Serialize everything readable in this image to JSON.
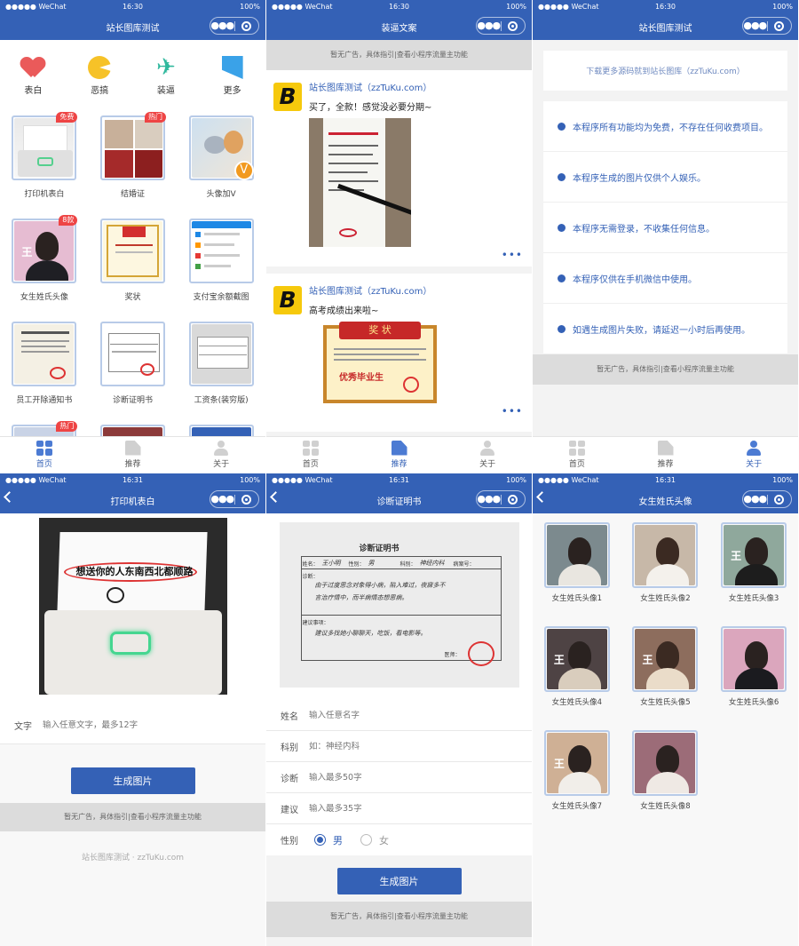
{
  "status": {
    "carrier": "●●●●● WeChat",
    "battery": "100%",
    "times": [
      "16:30",
      "16:30",
      "16:30",
      "16:31",
      "16:31",
      "16:31"
    ]
  },
  "titles": [
    "站长图库测试",
    "装逼文案",
    "站长图库测试",
    "打印机表白",
    "诊断证明书",
    "女生姓氏头像"
  ],
  "colors": {
    "primary": "#3461b6",
    "badge": "#ee4444"
  },
  "ad_text": "暂无广告，具体指引|查看小程序流量主功能",
  "tabbar": [
    {
      "label": "首页",
      "icon": "home-icon"
    },
    {
      "label": "推荐",
      "icon": "recommend-icon"
    },
    {
      "label": "关于",
      "icon": "about-icon"
    }
  ],
  "home": {
    "categories": [
      {
        "label": "表白",
        "icon": "heart-icon"
      },
      {
        "label": "恶搞",
        "icon": "smile-icon"
      },
      {
        "label": "装逼",
        "icon": "plane-icon"
      },
      {
        "label": "更多",
        "icon": "bookmark-icon"
      }
    ],
    "tiles": [
      {
        "label": "打印机表白",
        "badge": "免费"
      },
      {
        "label": "结婚证",
        "badge": "热门"
      },
      {
        "label": "头像加V",
        "badge": ""
      },
      {
        "label": "女生姓氏头像",
        "badge": "8款"
      },
      {
        "label": "奖状",
        "badge": ""
      },
      {
        "label": "支付宝余额截图",
        "badge": ""
      },
      {
        "label": "员工开除通知书",
        "badge": ""
      },
      {
        "label": "诊断证明书",
        "badge": ""
      },
      {
        "label": "工资条(装穷版)",
        "badge": ""
      }
    ],
    "partial_badge": "热门",
    "vbadge": "V"
  },
  "feed": {
    "posts": [
      {
        "name": "站长图库测试（zzTuKu.com）",
        "text": "买了，全款！感觉没必要分期~"
      },
      {
        "name": "站长图库测试（zzTuKu.com）",
        "text": "高考成绩出来啦~"
      }
    ],
    "logo": "B",
    "certificate": {
      "title": "奖 状",
      "banner": "优秀毕业生"
    }
  },
  "about": {
    "download_text": "下载更多源码就到站长图库（zzTuKu.com）",
    "notes": [
      "本程序所有功能均为免费，不存在任何收费项目。",
      "本程序生成的图片仅供个人娱乐。",
      "本程序无需登录，不收集任何信息。",
      "本程序仅供在手机微信中使用。",
      "如遇生成图片失败，请延迟一小时后再使用。"
    ]
  },
  "printer": {
    "paper_text": "想送你的人东南西北都顺路",
    "field_label": "文字",
    "field_placeholder": "输入任意文字，最多12字",
    "button": "生成图片",
    "footer": "站长图库测试 · zzTuKu.com"
  },
  "diagnosis": {
    "doc": {
      "title": "诊断证明书",
      "fields": [
        "姓名：",
        "性别：",
        "科别：",
        "病案号：",
        "诊断：",
        "建议事项：",
        "医师："
      ],
      "name_value": "王小明",
      "gender_value": "男",
      "dept_value": "神经内科",
      "diag_line1": "由于过度思念对象得小病，陷入难过，夜寐多不",
      "diag_line2": "言治疗情中，而半病情态想思病。",
      "advice": "建议多找她小聊聊天，吃饭，看电影等。"
    },
    "fields": [
      {
        "label": "姓名",
        "placeholder": "输入任意名字"
      },
      {
        "label": "科别",
        "placeholder": "如：神经内科"
      },
      {
        "label": "诊断",
        "placeholder": "输入最多50字"
      },
      {
        "label": "建议",
        "placeholder": "输入最多35字"
      }
    ],
    "gender_label": "性别",
    "gender_options": [
      "男",
      "女"
    ],
    "gender_selected": "男",
    "button": "生成图片"
  },
  "avatars": {
    "items": [
      "女生姓氏头像1",
      "女生姓氏头像2",
      "女生姓氏头像3",
      "女生姓氏头像4",
      "女生姓氏头像5",
      "女生姓氏头像6",
      "女生姓氏头像7",
      "女生姓氏头像8"
    ],
    "glyph": "王"
  }
}
